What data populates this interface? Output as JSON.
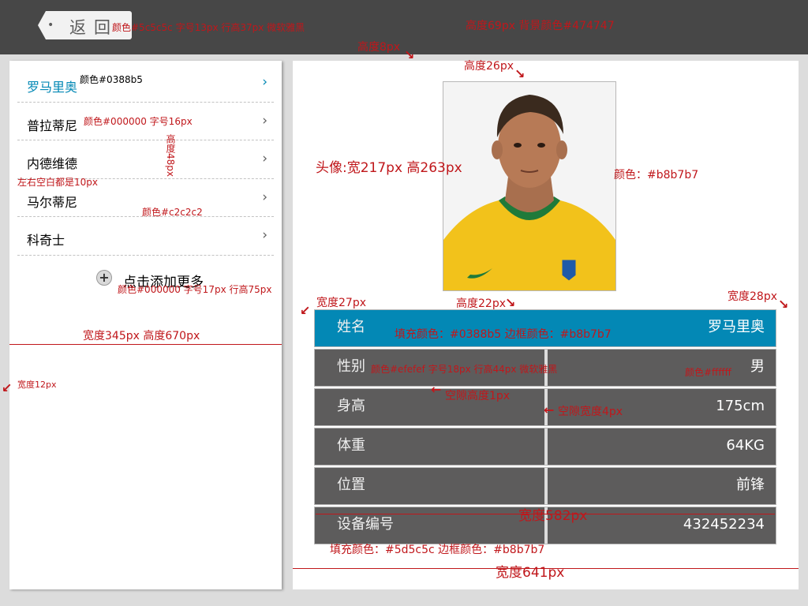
{
  "header": {
    "back_label": "返回",
    "back_dot": "•"
  },
  "sidebar": {
    "items": [
      {
        "label": "罗马里奥",
        "active": true
      },
      {
        "label": "普拉蒂尼",
        "active": false
      },
      {
        "label": "内德维德",
        "active": false
      },
      {
        "label": "马尔蒂尼",
        "active": false
      },
      {
        "label": "科奇士",
        "active": false
      }
    ],
    "chevron": "›",
    "add_more": "点击添加更多",
    "add_icon": "+"
  },
  "profile": {
    "rows": [
      {
        "key": "姓名",
        "value": "罗马里奥"
      },
      {
        "key": "性别",
        "value": "男"
      },
      {
        "key": "身高",
        "value": "175cm"
      },
      {
        "key": "体重",
        "value": "64KG"
      },
      {
        "key": "位置",
        "value": "前锋"
      },
      {
        "key": "设备编号",
        "value": "432452234"
      }
    ]
  },
  "annotations": {
    "back_btn": "颜色#5c5c5c 字号13px 行高37px 微软雅黑",
    "header": "高度69px 背景颜色#474747",
    "gap8": "高度8px",
    "gap26": "高度26px",
    "item_active": "颜色#0388b5",
    "item_normal": "颜色#000000  字号16px",
    "item_height": "高度48px",
    "padding": "左右空白都是10px",
    "divider_color": "颜色#c2c2c2",
    "add_more": "颜色#000000  字号17px 行高75px",
    "sidebar_size": "宽度345px  高度670px",
    "left_gap": "宽度12px",
    "avatar_size": "头像:宽217px 高263px",
    "avatar_border": "颜色：#b8b7b7",
    "width27": "宽度27px",
    "height22": "高度22px",
    "width28": "宽度28px",
    "active_fill": "填充颜色：#0388b5  边框颜色：#b8b7b7",
    "row_text": "颜色#efefef 字号18px 行高44px 微软雅黑",
    "value_color": "颜色#ffffff",
    "gap_height": "空隙高度1px",
    "gap_width": "空隙宽度4px",
    "table_width": "宽度582px",
    "row_fill": "填充颜色：#5d5c5c  边框颜色：#b8b7b7",
    "main_width": "宽度641px"
  }
}
